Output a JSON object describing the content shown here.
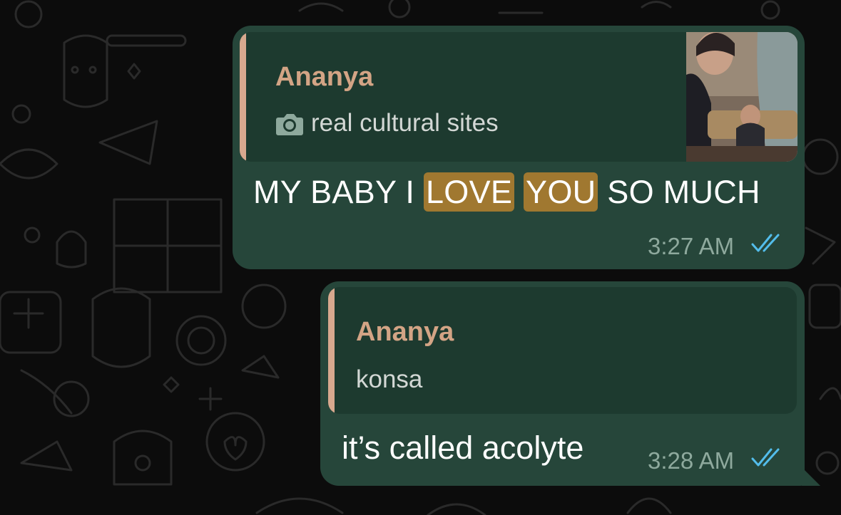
{
  "messages": [
    {
      "quote_name": "Ananya",
      "quote_text": "real cultural sites",
      "quote_icon": "camera-icon",
      "text_before": "MY BABY I ",
      "highlight_1": "LOVE",
      "highlight_2": "YOU",
      "text_after": " SO MUCH",
      "time": "3:27 AM",
      "status_icon": "double-check-read-icon"
    },
    {
      "quote_name": "Ananya",
      "quote_text": "konsa",
      "text": "it’s called acolyte",
      "time": "3:28 AM",
      "status_icon": "double-check-read-icon"
    }
  ],
  "colors": {
    "background": "#0c0c0c",
    "bubble": "#26463a",
    "quote_bg": "#1d3a2f",
    "quote_bar": "#d7a88e",
    "quote_name": "#d3a485",
    "highlight": "#a07830",
    "read_ticks": "#53bdeb"
  }
}
